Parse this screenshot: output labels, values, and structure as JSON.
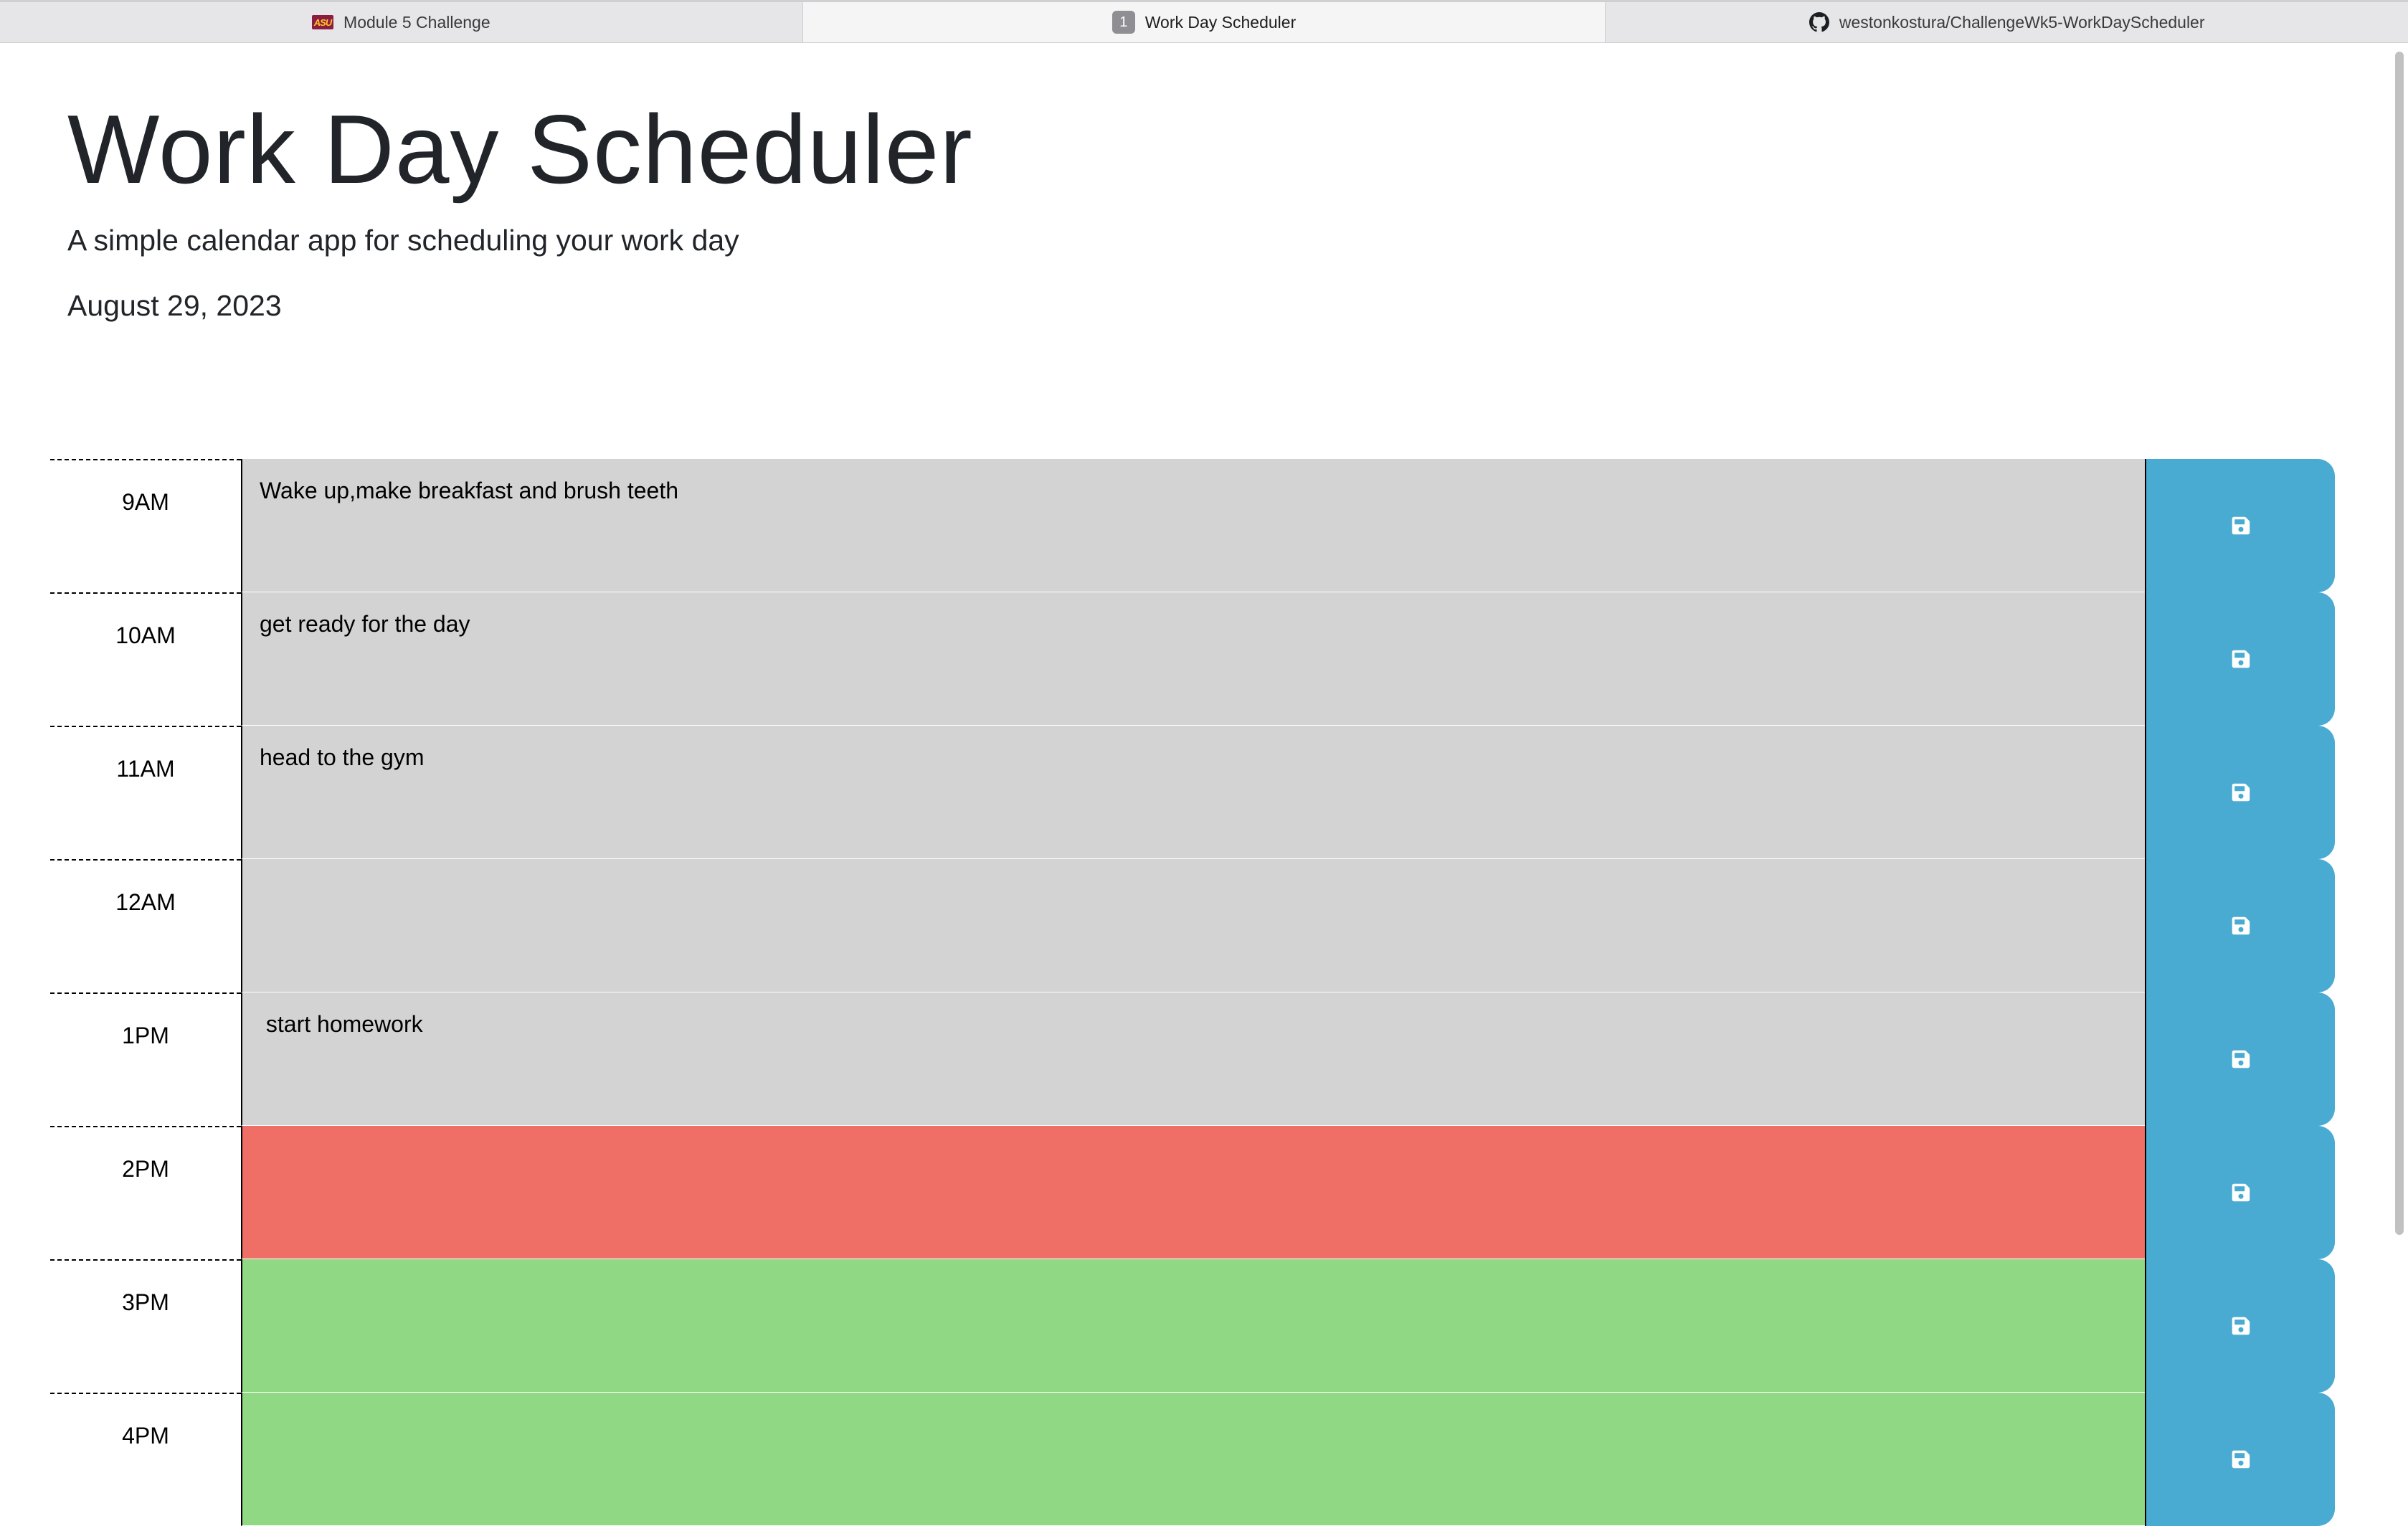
{
  "browser": {
    "tabs": [
      {
        "label": "Module 5 Challenge",
        "icon": "asu-logo-icon",
        "favicon_text": "ASU"
      },
      {
        "label": "Work Day Scheduler",
        "icon": "tab-number-icon",
        "favicon_text": "1"
      },
      {
        "label": "westonkostura/ChallengeWk5-WorkDayScheduler",
        "icon": "github-icon"
      }
    ],
    "active_tab": 1
  },
  "header": {
    "title": "Work Day Scheduler",
    "lead": "A simple calendar app for scheduling your work day",
    "current_day": "August 29, 2023"
  },
  "schedule": {
    "rows": [
      {
        "hour": "9AM",
        "text": "Wake up,make breakfast and brush teeth",
        "status": "past"
      },
      {
        "hour": "10AM",
        "text": "get ready for the day",
        "status": "past"
      },
      {
        "hour": "11AM",
        "text": "head to the gym",
        "status": "past"
      },
      {
        "hour": "12AM",
        "text": "",
        "status": "past"
      },
      {
        "hour": "1PM",
        "text": " start homework",
        "status": "past"
      },
      {
        "hour": "2PM",
        "text": "",
        "status": "present"
      },
      {
        "hour": "3PM",
        "text": "",
        "status": "future"
      },
      {
        "hour": "4PM",
        "text": "",
        "status": "future"
      }
    ],
    "save_icon": "floppy-disk-icon"
  },
  "colors": {
    "past": "#d3d3d3",
    "present": "#ef6f66",
    "future": "#91d885",
    "save_button": "#4aabd2"
  }
}
